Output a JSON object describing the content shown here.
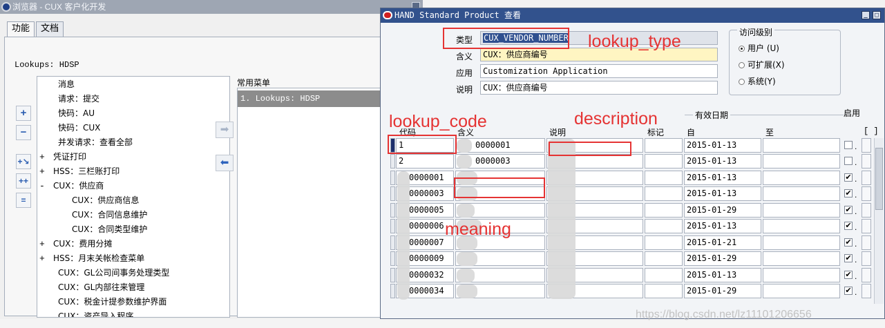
{
  "navigator": {
    "title": "浏览器 - CUX 客户化开发",
    "tabs": [
      {
        "label": "功能"
      },
      {
        "label": "文档"
      }
    ],
    "current": "Lookups: HDSP",
    "tree": [
      {
        "sign": "",
        "label": "消息"
      },
      {
        "sign": "",
        "label": "请求：提交"
      },
      {
        "sign": "",
        "label": "快码：AU"
      },
      {
        "sign": "",
        "label": "快码：CUX"
      },
      {
        "sign": "",
        "label": "并发请求：查看全部"
      },
      {
        "sign": "+",
        "label": "凭证打印"
      },
      {
        "sign": "+",
        "label": "HSS：三栏账打印"
      },
      {
        "sign": "-",
        "label": "CUX：供应商"
      },
      {
        "sign": "",
        "label": "CUX：供应商信息"
      },
      {
        "sign": "",
        "label": "CUX：合同信息维护"
      },
      {
        "sign": "",
        "label": "CUX：合同类型维护"
      },
      {
        "sign": "+",
        "label": "CUX：费用分摊"
      },
      {
        "sign": "+",
        "label": "HSS：月末关帐检查菜单"
      },
      {
        "sign": "",
        "label": "CUX：GL公司间事务处理类型"
      },
      {
        "sign": "",
        "label": "CUX：GL内部往来管理"
      },
      {
        "sign": "",
        "label": "CUX：税金计提参数维护界面"
      },
      {
        "sign": "",
        "label": "CUX：资产导入程序"
      }
    ],
    "favorites_label": "常用菜单",
    "favorites": [
      {
        "label": "1. Lookups: HDSP"
      }
    ]
  },
  "form": {
    "title": "HAND Standard Product 查看",
    "fields": {
      "type_label": "类型",
      "type_value": "CUX_VENDOR_NUMBER",
      "meaning_label": "含义",
      "meaning_value": "CUX：供应商编号",
      "application_label": "应用",
      "application_value": "Customization Application",
      "description_label": "说明",
      "description_value": "CUX：供应商编号"
    },
    "access": {
      "title": "访问级别",
      "options": [
        {
          "label": "用户 (U)",
          "selected": true
        },
        {
          "label": "可扩展(X)",
          "selected": false
        },
        {
          "label": "系统(Y)",
          "selected": false
        }
      ]
    },
    "effective_date_label": "有效日期",
    "enabled_label": "启用",
    "bracket_label": "[ ]",
    "columns": {
      "code": "代码",
      "meaning": "含义",
      "description": "说明",
      "tag": "标记",
      "from": "自",
      "to": "至"
    },
    "rows": [
      {
        "code": "1",
        "meaning": "0000001",
        "description": "",
        "tag": "",
        "from": "2015-01-13",
        "to": "",
        "enabled": false
      },
      {
        "code": "2",
        "meaning": "0000003",
        "description": "",
        "tag": "",
        "from": "2015-01-13",
        "to": "",
        "enabled": false
      },
      {
        "code": "0000001",
        "meaning": "",
        "description": "",
        "tag": "",
        "from": "2015-01-13",
        "to": "",
        "enabled": true
      },
      {
        "code": "0000003",
        "meaning": "",
        "description": "",
        "tag": "",
        "from": "2015-01-13",
        "to": "",
        "enabled": true
      },
      {
        "code": "0000005",
        "meaning": "",
        "description": "",
        "tag": "",
        "from": "2015-01-29",
        "to": "",
        "enabled": true
      },
      {
        "code": "0000006",
        "meaning": "",
        "description": "",
        "tag": "",
        "from": "2015-01-13",
        "to": "",
        "enabled": true
      },
      {
        "code": "0000007",
        "meaning": "",
        "description": "",
        "tag": "",
        "from": "2015-01-21",
        "to": "",
        "enabled": true
      },
      {
        "code": "0000009",
        "meaning": "",
        "description": "",
        "tag": "",
        "from": "2015-01-29",
        "to": "",
        "enabled": true
      },
      {
        "code": "0000032",
        "meaning": "",
        "description": "",
        "tag": "",
        "from": "2015-01-13",
        "to": "",
        "enabled": true
      },
      {
        "code": "0000034",
        "meaning": "",
        "description": "",
        "tag": "",
        "from": "2015-01-29",
        "to": "",
        "enabled": true
      }
    ]
  },
  "annotations": {
    "lookup_type": "lookup_type",
    "lookup_code": "lookup_code",
    "description": "description",
    "meaning": "meaning"
  },
  "watermark": "https://blog.csdn.net/lz11101206656",
  "colors": {
    "annotation": "#e53333",
    "form_title_bar": "#32528d",
    "favorite_selected": "#8c8c8c"
  }
}
